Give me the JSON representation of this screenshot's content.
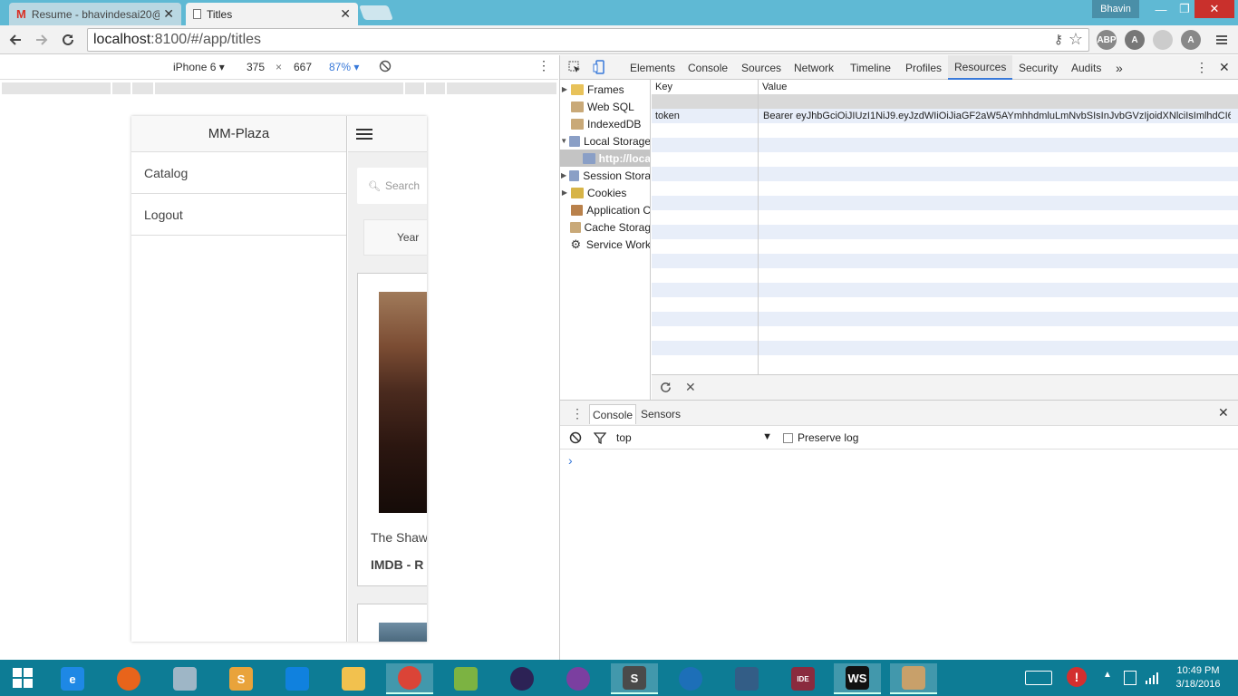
{
  "browser": {
    "tabs": [
      {
        "title": "Resume - bhavindesai20@",
        "close": "✕",
        "active": false
      },
      {
        "title": "Titles",
        "close": "✕",
        "active": true
      }
    ],
    "user": "Bhavin",
    "window_controls": {
      "minimize": "—",
      "maximize": "❐",
      "close": "✕"
    },
    "url_host": "localhost",
    "url_rest": ":8100/#/app/titles",
    "extensions": [
      "ABP",
      "A",
      "A"
    ]
  },
  "device_toolbar": {
    "device": "iPhone 6",
    "width": "375",
    "times": "×",
    "height": "667",
    "zoom": "87%"
  },
  "app": {
    "menu_title": "MM-Plaza",
    "menu_items": [
      "Catalog",
      "Logout"
    ],
    "search_placeholder": "Search",
    "year_button": "Year",
    "card_title": "The Shaw",
    "card_rating": "IMDB - R"
  },
  "devtools": {
    "tabs": [
      "Elements",
      "Console",
      "Sources",
      "Network",
      "Timeline",
      "Profiles",
      "Resources",
      "Security",
      "Audits"
    ],
    "selected_tab": "Resources",
    "more": "»",
    "tree": [
      {
        "label": "Frames",
        "expandable": true,
        "icon": "folder-icon"
      },
      {
        "label": "Web SQL",
        "expandable": false,
        "icon": "database-icon"
      },
      {
        "label": "IndexedDB",
        "expandable": false,
        "icon": "database-icon"
      },
      {
        "label": "Local Storage",
        "expandable": true,
        "expanded": true,
        "icon": "storage-grid-icon"
      },
      {
        "label": "http://loca",
        "child": true,
        "selected": true,
        "icon": "storage-grid-icon"
      },
      {
        "label": "Session Stora",
        "expandable": true,
        "icon": "storage-grid-icon"
      },
      {
        "label": "Cookies",
        "expandable": true,
        "icon": "cookie-icon"
      },
      {
        "label": "Application C",
        "expandable": false,
        "icon": "cache-grid-icon"
      },
      {
        "label": "Cache Storag",
        "expandable": false,
        "icon": "database-icon"
      },
      {
        "label": "Service Work",
        "expandable": false,
        "icon": "gear-icon"
      }
    ],
    "grid": {
      "key_header": "Key",
      "value_header": "Value",
      "rows": [
        {
          "key": "token",
          "value": "Bearer eyJhbGciOiJIUzI1NiJ9.eyJzdWIiOiJiaGF2aW5AYmhhdmluLmNvbSIsInJvbGVzIjoidXNlciIsImlhdCI6..."
        }
      ]
    },
    "drawer_tabs": [
      "Console",
      "Sensors"
    ],
    "console_context": "top",
    "preserve_log_label": "Preserve log",
    "prompt": "›"
  },
  "taskbar": {
    "time": "10:49 PM",
    "date": "3/18/2016",
    "apps": [
      {
        "name": "internet-explorer-icon",
        "label": "e",
        "color": "#1e88e5"
      },
      {
        "name": "firefox-icon",
        "label": "",
        "color": "#e8641b"
      },
      {
        "name": "database-tool-icon",
        "label": "",
        "color": "#9eb6c6"
      },
      {
        "name": "slack-icon",
        "label": "S",
        "color": "#e9a33b"
      },
      {
        "name": "dropbox-icon",
        "label": "",
        "color": "#1081de"
      },
      {
        "name": "file-explorer-icon",
        "label": "",
        "color": "#f2c14e"
      },
      {
        "name": "chrome-icon",
        "label": "",
        "color": "#db4437",
        "active": true
      },
      {
        "name": "notepad-icon",
        "label": "",
        "color": "#7cb342"
      },
      {
        "name": "eclipse-icon",
        "label": "",
        "color": "#2c2255"
      },
      {
        "name": "eclipse-ee-icon",
        "label": "",
        "color": "#7b3fa0"
      },
      {
        "name": "sublime-text-icon",
        "label": "S",
        "color": "#4a4a4a",
        "active": true
      },
      {
        "name": "sourcetree-icon",
        "label": "",
        "color": "#1d6fb8"
      },
      {
        "name": "mysql-workbench-icon",
        "label": "",
        "color": "#335d86"
      },
      {
        "name": "javaee-ide-icon",
        "label": "IDE",
        "color": "#8a2b3e"
      },
      {
        "name": "webstorm-icon",
        "label": "WS",
        "color": "#111111",
        "active": true
      },
      {
        "name": "paint-icon",
        "label": "",
        "color": "#c8a06a",
        "active": true
      }
    ]
  },
  "colors": {
    "titlebar": "#5fb9d4",
    "taskbar": "#0d7c95",
    "devtools_accent": "#3879d9",
    "zoom_text": "#3879d9"
  }
}
